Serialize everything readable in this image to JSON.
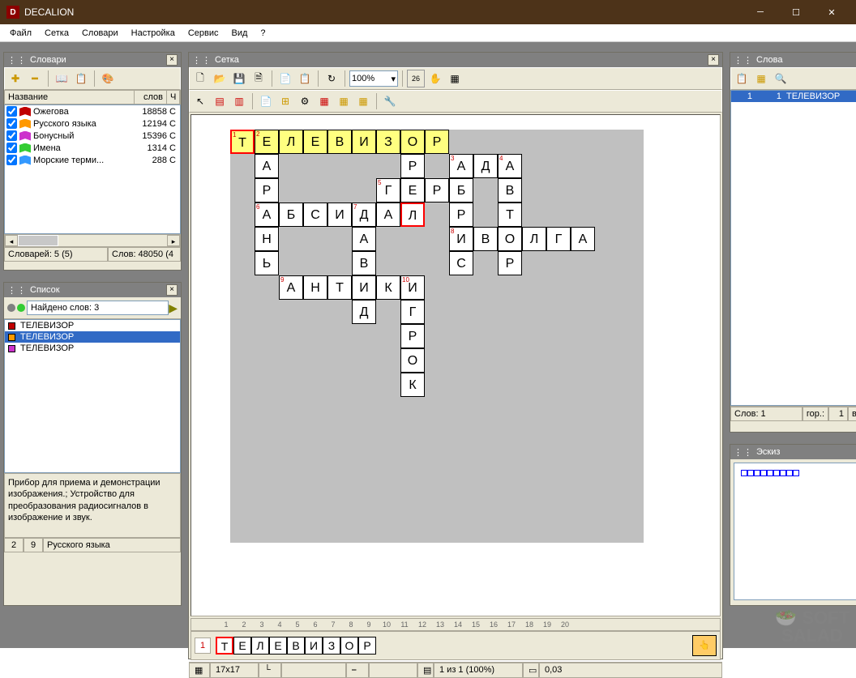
{
  "app": {
    "title": "DECALION",
    "icon_letter": "D"
  },
  "menu": [
    "Файл",
    "Сетка",
    "Словари",
    "Настройка",
    "Сервис",
    "Вид",
    "?"
  ],
  "panels": {
    "dict": {
      "title": "Словари"
    },
    "list": {
      "title": "Список"
    },
    "grid": {
      "title": "Сетка"
    },
    "words": {
      "title": "Слова"
    },
    "sketch": {
      "title": "Эскиз"
    }
  },
  "dict": {
    "headers": {
      "name": "Название",
      "words": "слов",
      "mark": "Ч"
    },
    "items": [
      {
        "name": "Ожегова",
        "count": "18858",
        "color": "#c00000",
        "mark": "С"
      },
      {
        "name": "Русского языка",
        "count": "12194",
        "color": "#ff9900",
        "mark": "С"
      },
      {
        "name": "Бонусный",
        "count": "15396",
        "color": "#cc33cc",
        "mark": "С"
      },
      {
        "name": "Имена",
        "count": "1314",
        "color": "#33cc33",
        "mark": "С"
      },
      {
        "name": "Морские терми...",
        "count": "288",
        "color": "#3399ff",
        "mark": "С"
      }
    ],
    "status": {
      "dicts": "Словарей: 5 (5)",
      "words": "Слов: 48050 (4"
    }
  },
  "list": {
    "found": "Найдено слов: 3",
    "items": [
      {
        "text": "ТЕЛЕВИЗОР",
        "color": "#c00000"
      },
      {
        "text": "ТЕЛЕВИЗОР",
        "color": "#ff9900",
        "selected": true
      },
      {
        "text": "ТЕЛЕВИЗОР",
        "color": "#cc33cc"
      }
    ],
    "definition": "Прибор для приема и демонстрации изображения.; Устройство для преобразования радиосигналов в изображение и звук.",
    "status": {
      "n": "2",
      "len": "9",
      "dict": "Русского языка"
    }
  },
  "grid": {
    "zoom": "100%",
    "size": "17x17",
    "status_pages": "1 из 1 (100%)",
    "status_density": "0,03",
    "cells": [
      {
        "r": 0,
        "c": 0,
        "l": "Т",
        "n": "1",
        "hl": true,
        "sel": true
      },
      {
        "r": 0,
        "c": 1,
        "l": "Е",
        "n": "2",
        "hl": true
      },
      {
        "r": 0,
        "c": 2,
        "l": "Л",
        "hl": true
      },
      {
        "r": 0,
        "c": 3,
        "l": "Е",
        "hl": true
      },
      {
        "r": 0,
        "c": 4,
        "l": "В",
        "hl": true
      },
      {
        "r": 0,
        "c": 5,
        "l": "И",
        "hl": true
      },
      {
        "r": 0,
        "c": 6,
        "l": "З",
        "hl": true
      },
      {
        "r": 0,
        "c": 7,
        "l": "О",
        "hl": true
      },
      {
        "r": 0,
        "c": 8,
        "l": "Р",
        "hl": true
      },
      {
        "r": 1,
        "c": 1,
        "l": "А"
      },
      {
        "r": 1,
        "c": 7,
        "l": "Р"
      },
      {
        "r": 1,
        "c": 9,
        "l": "А",
        "n": "3"
      },
      {
        "r": 1,
        "c": 10,
        "l": "Д"
      },
      {
        "r": 1,
        "c": 11,
        "l": "А",
        "n": "4"
      },
      {
        "r": 2,
        "c": 1,
        "l": "Р"
      },
      {
        "r": 2,
        "c": 6,
        "l": "Г",
        "n": "5"
      },
      {
        "r": 2,
        "c": 7,
        "l": "Е"
      },
      {
        "r": 2,
        "c": 8,
        "l": "Р"
      },
      {
        "r": 2,
        "c": 9,
        "l": "Б"
      },
      {
        "r": 2,
        "c": 11,
        "l": "В"
      },
      {
        "r": 3,
        "c": 1,
        "l": "А",
        "n": "6"
      },
      {
        "r": 3,
        "c": 2,
        "l": "Б"
      },
      {
        "r": 3,
        "c": 3,
        "l": "С"
      },
      {
        "r": 3,
        "c": 4,
        "l": "И"
      },
      {
        "r": 3,
        "c": 5,
        "l": "Д",
        "n": "7"
      },
      {
        "r": 3,
        "c": 6,
        "l": "А"
      },
      {
        "r": 3,
        "c": 7,
        "l": "Л",
        "sel": true
      },
      {
        "r": 3,
        "c": 9,
        "l": "Р"
      },
      {
        "r": 3,
        "c": 11,
        "l": "Т"
      },
      {
        "r": 4,
        "c": 1,
        "l": "Н"
      },
      {
        "r": 4,
        "c": 5,
        "l": "А"
      },
      {
        "r": 4,
        "c": 9,
        "l": "И",
        "n": "8"
      },
      {
        "r": 4,
        "c": 10,
        "l": "В"
      },
      {
        "r": 4,
        "c": 11,
        "l": "О"
      },
      {
        "r": 4,
        "c": 12,
        "l": "Л"
      },
      {
        "r": 4,
        "c": 13,
        "l": "Г"
      },
      {
        "r": 4,
        "c": 14,
        "l": "А"
      },
      {
        "r": 5,
        "c": 1,
        "l": "Ь"
      },
      {
        "r": 5,
        "c": 5,
        "l": "В"
      },
      {
        "r": 5,
        "c": 9,
        "l": "С"
      },
      {
        "r": 5,
        "c": 11,
        "l": "Р"
      },
      {
        "r": 6,
        "c": 2,
        "l": "А",
        "n": "9"
      },
      {
        "r": 6,
        "c": 3,
        "l": "Н"
      },
      {
        "r": 6,
        "c": 4,
        "l": "Т"
      },
      {
        "r": 6,
        "c": 5,
        "l": "И"
      },
      {
        "r": 6,
        "c": 6,
        "l": "К"
      },
      {
        "r": 6,
        "c": 7,
        "l": "И",
        "n": "10"
      },
      {
        "r": 7,
        "c": 5,
        "l": "Д"
      },
      {
        "r": 7,
        "c": 7,
        "l": "Г"
      },
      {
        "r": 8,
        "c": 7,
        "l": "Р"
      },
      {
        "r": 9,
        "c": 7,
        "l": "О"
      },
      {
        "r": 10,
        "c": 7,
        "l": "К"
      }
    ],
    "ruler": [
      "1",
      "2",
      "3",
      "4",
      "5",
      "6",
      "7",
      "8",
      "9",
      "10",
      "11",
      "12",
      "13",
      "14",
      "15",
      "16",
      "17",
      "18",
      "19",
      "20"
    ],
    "current_num": "1",
    "current_word": [
      "Т",
      "Е",
      "Л",
      "Е",
      "В",
      "И",
      "З",
      "О",
      "Р"
    ]
  },
  "words": {
    "items": [
      {
        "n": "1",
        "idx": "1",
        "text": "ТЕЛЕВИЗОР",
        "selected": true
      }
    ],
    "status": {
      "total": "Слов: 1",
      "h_label": "гор.:",
      "h": "1",
      "v_label": "вер"
    }
  },
  "watermark": "SOFT\nSALAD"
}
